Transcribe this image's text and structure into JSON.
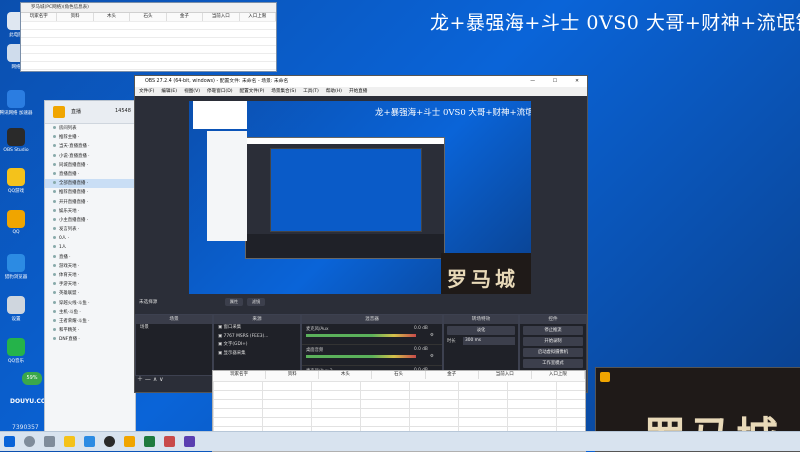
{
  "desktop": {
    "banner_text": "龙+暴强海+斗士 0VS0 大哥+财神+流氓锅",
    "icons": [
      {
        "label": "此电脑",
        "color": "#dfe7f1"
      },
      {
        "label": "网络",
        "color": "#cfdcec"
      },
      {
        "label": "腾讯网络 加速器",
        "color": "#2b7de1"
      },
      {
        "label": "OBS Studio",
        "color": "#2a2a2a"
      },
      {
        "label": "QQ游戏",
        "color": "#f4c21b"
      },
      {
        "label": "QQ",
        "color": "#f0a500"
      },
      {
        "label": "猎豹浏览器",
        "color": "#2c8be3"
      },
      {
        "label": "设置",
        "color": "#cfd6de"
      },
      {
        "label": "QQ音乐",
        "color": "#25b34a"
      },
      {
        "label": "斗鱼直播",
        "color": "#3aa84b"
      }
    ],
    "douyu_badge": "59%",
    "douyu_logo": "DOUYU.COM",
    "room_id": "7390357",
    "right_tile_text": "罗马城"
  },
  "small_window": {
    "title": "罗马城(PC网络)(角色信息表)",
    "columns": [
      "玩家名字",
      "资料",
      "木头",
      "石头",
      "金子",
      "当前入口",
      "入口上限"
    ]
  },
  "sidebar": {
    "window_title": "直播",
    "room_number": "14548",
    "items": [
      {
        "label": "房间列表",
        "highlight": false
      },
      {
        "label": "推荐主播 ·",
        "highlight": false
      },
      {
        "label": "当天·直播直播 ·",
        "highlight": false
      },
      {
        "label": "小说·直播直播 ·",
        "highlight": false
      },
      {
        "label": "同城直播直播 ·",
        "highlight": false
      },
      {
        "label": "直播直播 ·",
        "highlight": false
      },
      {
        "label": "全部直播直播 ·",
        "highlight": true
      },
      {
        "label": "推荐直播直播 ·",
        "highlight": false
      },
      {
        "label": "开开直播直播 ·",
        "highlight": false
      },
      {
        "label": "娱乐天地 ·",
        "highlight": false
      },
      {
        "label": "小主直播直播 ·",
        "highlight": false
      },
      {
        "label": "发言列表 ·",
        "highlight": false
      },
      {
        "label": "0人 ·",
        "highlight": false
      },
      {
        "label": "1人",
        "highlight": false
      },
      {
        "label": "直播 ·",
        "highlight": false
      },
      {
        "label": "游戏天地 ·",
        "highlight": false
      },
      {
        "label": "体育天地 ·",
        "highlight": false
      },
      {
        "label": "手游天地 ·",
        "highlight": false
      },
      {
        "label": "英雄联盟 ·",
        "highlight": false
      },
      {
        "label": "穿越火线·斗鱼 ·",
        "highlight": false
      },
      {
        "label": "主机·斗鱼 ·",
        "highlight": false
      },
      {
        "label": "王者荣耀·斗鱼 ·",
        "highlight": false
      },
      {
        "label": "和平精英 ·",
        "highlight": false
      },
      {
        "label": "DNF直播 ·",
        "highlight": false
      }
    ]
  },
  "obs": {
    "title": "OBS 27.2.4 (64-bit, windows) - 配置文件: 未命名 - 场景: 未命名",
    "menu": [
      "文件(F)",
      "编辑(E)",
      "视图(V)",
      "停靠窗口(D)",
      "配置文件(P)",
      "场景集合(S)",
      "工具(T)",
      "帮助(H)",
      "开始直播"
    ],
    "status_label": "未选择源",
    "properties_btn": "属性",
    "filters_btn": "滤镜",
    "panels": {
      "scenes": "场景",
      "sources": "来源",
      "mixer": "混音器",
      "transitions": "转场特效",
      "controls": "控件"
    },
    "scene_list": [
      "场景"
    ],
    "sources": [
      "窗口采集",
      "7767 MSRS (FEE3)...",
      "文字(GDI+)",
      "显示器采集"
    ],
    "mixer_tracks": [
      {
        "name": "麦克风/Aux",
        "level": "0.0 dB"
      },
      {
        "name": "桌面音频",
        "level": "0.0 dB"
      },
      {
        "name": "麦克风/Aux 2",
        "level": "0.0 dB"
      }
    ],
    "transition": "淡化",
    "duration_label": "时长",
    "duration_value": "300 ms",
    "controls": [
      "停止推流",
      "开始录制",
      "启动虚拟摄像机",
      "工作室模式",
      "设置",
      "退出"
    ]
  },
  "sheet": {
    "columns": [
      "玩家名字",
      "资料",
      "木头",
      "石头",
      "金子",
      "当前入口",
      "入口上限"
    ]
  }
}
